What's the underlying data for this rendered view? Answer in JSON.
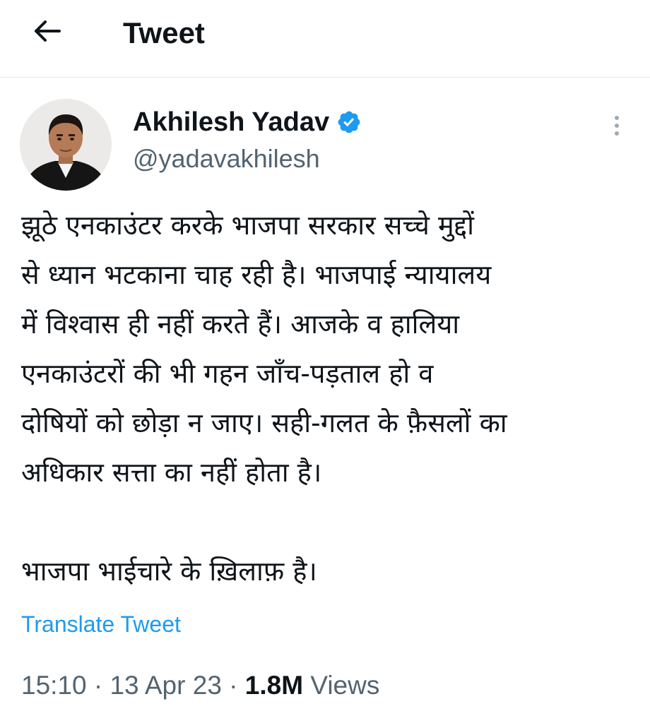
{
  "header": {
    "back_icon": "arrow-left-icon",
    "title": "Tweet"
  },
  "author": {
    "name": "Akhilesh Yadav",
    "handle": "@yadavakhilesh",
    "verified_icon": "verified-badge-icon",
    "verified_color": "#1d9bf0"
  },
  "more_icon": "more-vertical-icon",
  "tweet": {
    "lines": [
      "झूठे एनकाउंटर करके भाजपा सरकार सच्चे मुद्दों",
      "से ध्यान भटकाना चाह रही है। भाजपाई न्यायालय",
      "में विश्वास ही नहीं करते हैं। आजके व हालिया",
      "एनकाउंटरों की भी गहन जाँच-पड़ताल हो व",
      "दोषियों को छोड़ा न जाए। सही-गलत के फ़ैसलों का",
      "अधिकार सत्ता का नहीं होता है।",
      "",
      "भाजपा भाईचारे के ख़िलाफ़ है।"
    ]
  },
  "translate_label": "Translate Tweet",
  "meta": {
    "time": "15:10",
    "separator": " · ",
    "date": "13 Apr 23",
    "views_count": "1.8M",
    "views_label": " Views"
  },
  "colors": {
    "accent": "#1d9bf0",
    "text": "#0f1419",
    "secondary": "#536471",
    "divider": "#e7e9ea"
  }
}
